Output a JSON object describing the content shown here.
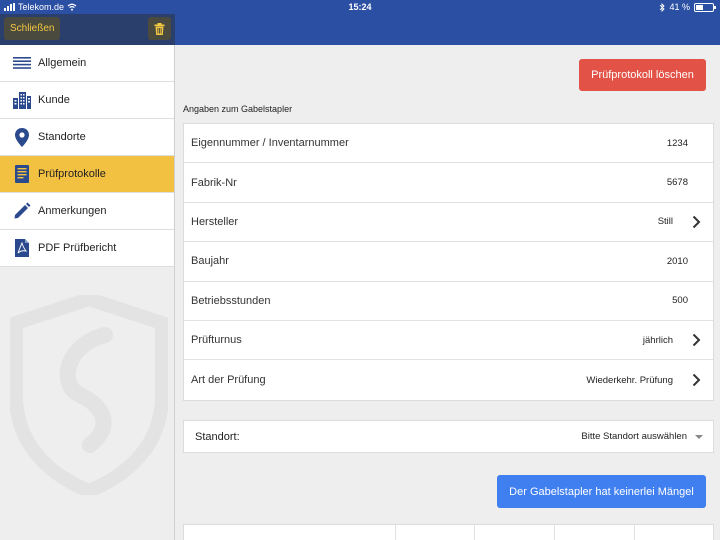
{
  "status_bar": {
    "carrier": "Telekom.de",
    "time": "15:24",
    "battery": "41 %",
    "battery_level": 0.41
  },
  "header": {
    "close_label": "Schließen",
    "trash_icon": "trash-icon"
  },
  "sidebar": {
    "items": [
      {
        "label": "Allgemein",
        "icon": "list-icon",
        "active": false
      },
      {
        "label": "Kunde",
        "icon": "building-icon",
        "active": false
      },
      {
        "label": "Standorte",
        "icon": "location-pin-icon",
        "active": false
      },
      {
        "label": "Prüfprotokolle",
        "icon": "document-icon",
        "active": true
      },
      {
        "label": "Anmerkungen",
        "icon": "pencil-icon",
        "active": false
      },
      {
        "label": "PDF Prüfbericht",
        "icon": "pdf-icon",
        "active": false
      }
    ]
  },
  "main": {
    "delete_label": "Prüfprotokoll löschen",
    "section_title": "Angaben zum Gabelstapler",
    "fields": [
      {
        "label": "Eigennummer / Inventarnummer",
        "value": "1234",
        "chevron": false
      },
      {
        "label": "Fabrik-Nr",
        "value": "5678",
        "chevron": false
      },
      {
        "label": "Hersteller",
        "value": "Still",
        "chevron": true
      },
      {
        "label": "Baujahr",
        "value": "2010",
        "chevron": false
      },
      {
        "label": "Betriebsstunden",
        "value": "500",
        "chevron": false
      },
      {
        "label": "Prüfturnus",
        "value": "jährlich",
        "chevron": true
      },
      {
        "label": "Art der Prüfung",
        "value": "Wiederkehr. Prüfung",
        "chevron": true
      }
    ],
    "standort": {
      "label": "Standort:",
      "placeholder": "Bitte Standort auswählen"
    },
    "no_defects_label": "Der Gabelstapler hat keinerlei Mängel"
  },
  "colors": {
    "brand_blue": "#2a4fa3",
    "active_yellow": "#f3c142",
    "danger_red": "#e35246",
    "action_blue": "#3f7ff0"
  }
}
